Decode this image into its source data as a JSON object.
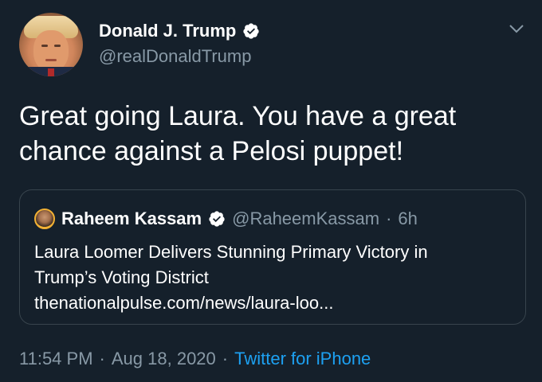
{
  "author": {
    "display_name": "Donald J. Trump",
    "handle": "@realDonaldTrump",
    "verified": true
  },
  "tweet": {
    "text_line1": "Great going Laura. You have a great",
    "text_line2": "chance against a Pelosi puppet!"
  },
  "quoted_tweet": {
    "display_name": "Raheem Kassam",
    "verified": true,
    "handle": "@RaheemKassam",
    "separator": "·",
    "time_ago": "6h",
    "body_line1": "Laura Loomer Delivers Stunning Primary Victory in",
    "body_line2": "Trump’s Voting District",
    "body_line3": "thenationalpulse.com/news/laura-loo..."
  },
  "meta": {
    "time": "11:54 PM",
    "dot1": "·",
    "date": "Aug 18, 2020",
    "dot2": "·",
    "source": "Twitter for iPhone"
  },
  "colors": {
    "background": "#15202b",
    "text_primary": "#ffffff",
    "text_secondary": "#8899a6",
    "accent": "#1da1f2",
    "border": "#38444d"
  },
  "icons": {
    "verified": "verified-badge-icon",
    "caret": "chevron-down-icon"
  }
}
